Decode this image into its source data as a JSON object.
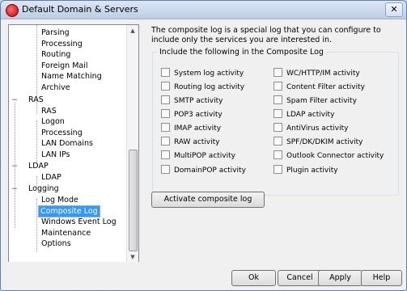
{
  "window": {
    "title": "Default Domain & Servers",
    "close_symbol": "✕"
  },
  "tree": {
    "items": [
      {
        "label": "Parsing"
      },
      {
        "label": "Processing"
      },
      {
        "label": "Routing"
      },
      {
        "label": "Foreign Mail"
      },
      {
        "label": "Name Matching"
      },
      {
        "label": "Archive"
      },
      {
        "label": "RAS"
      },
      {
        "label": "RAS"
      },
      {
        "label": "Logon"
      },
      {
        "label": "Processing"
      },
      {
        "label": "LAN Domains"
      },
      {
        "label": "LAN IPs"
      },
      {
        "label": "LDAP"
      },
      {
        "label": "LDAP"
      },
      {
        "label": "Logging"
      },
      {
        "label": "Log Mode"
      },
      {
        "label": "Composite Log"
      },
      {
        "label": "Windows Event Log"
      },
      {
        "label": "Maintenance"
      },
      {
        "label": "Options"
      }
    ],
    "collapse_symbol": "−"
  },
  "description": "The composite log is a special log that you can configure to include only the services you are interested in.",
  "group": {
    "title": "Include the following in the Composite Log",
    "left_options": [
      {
        "label": "System log activity",
        "checked": false
      },
      {
        "label": "Routing log activity",
        "checked": false
      },
      {
        "label": "SMTP activity",
        "checked": false
      },
      {
        "label": "POP3 activity",
        "checked": false
      },
      {
        "label": "IMAP activity",
        "checked": false
      },
      {
        "label": "RAW activity",
        "checked": false
      },
      {
        "label": "MultiPOP activity",
        "checked": false
      },
      {
        "label": "DomainPOP activity",
        "checked": false
      }
    ],
    "right_options": [
      {
        "label": "WC/HTTP/IM activity",
        "checked": false
      },
      {
        "label": "Content Filter activity",
        "checked": false
      },
      {
        "label": "Spam Filter activity",
        "checked": false
      },
      {
        "label": "LDAP activity",
        "checked": false
      },
      {
        "label": "AntiVirus activity",
        "checked": false
      },
      {
        "label": "SPF/DK/DKIM activity",
        "checked": false
      },
      {
        "label": "Outlook Connector activity",
        "checked": false
      },
      {
        "label": "Plugin activity",
        "checked": false
      }
    ]
  },
  "activate_button": "Activate composite log",
  "buttons": {
    "ok": "Ok",
    "cancel": "Cancel",
    "apply": "Apply",
    "help": "Help"
  }
}
